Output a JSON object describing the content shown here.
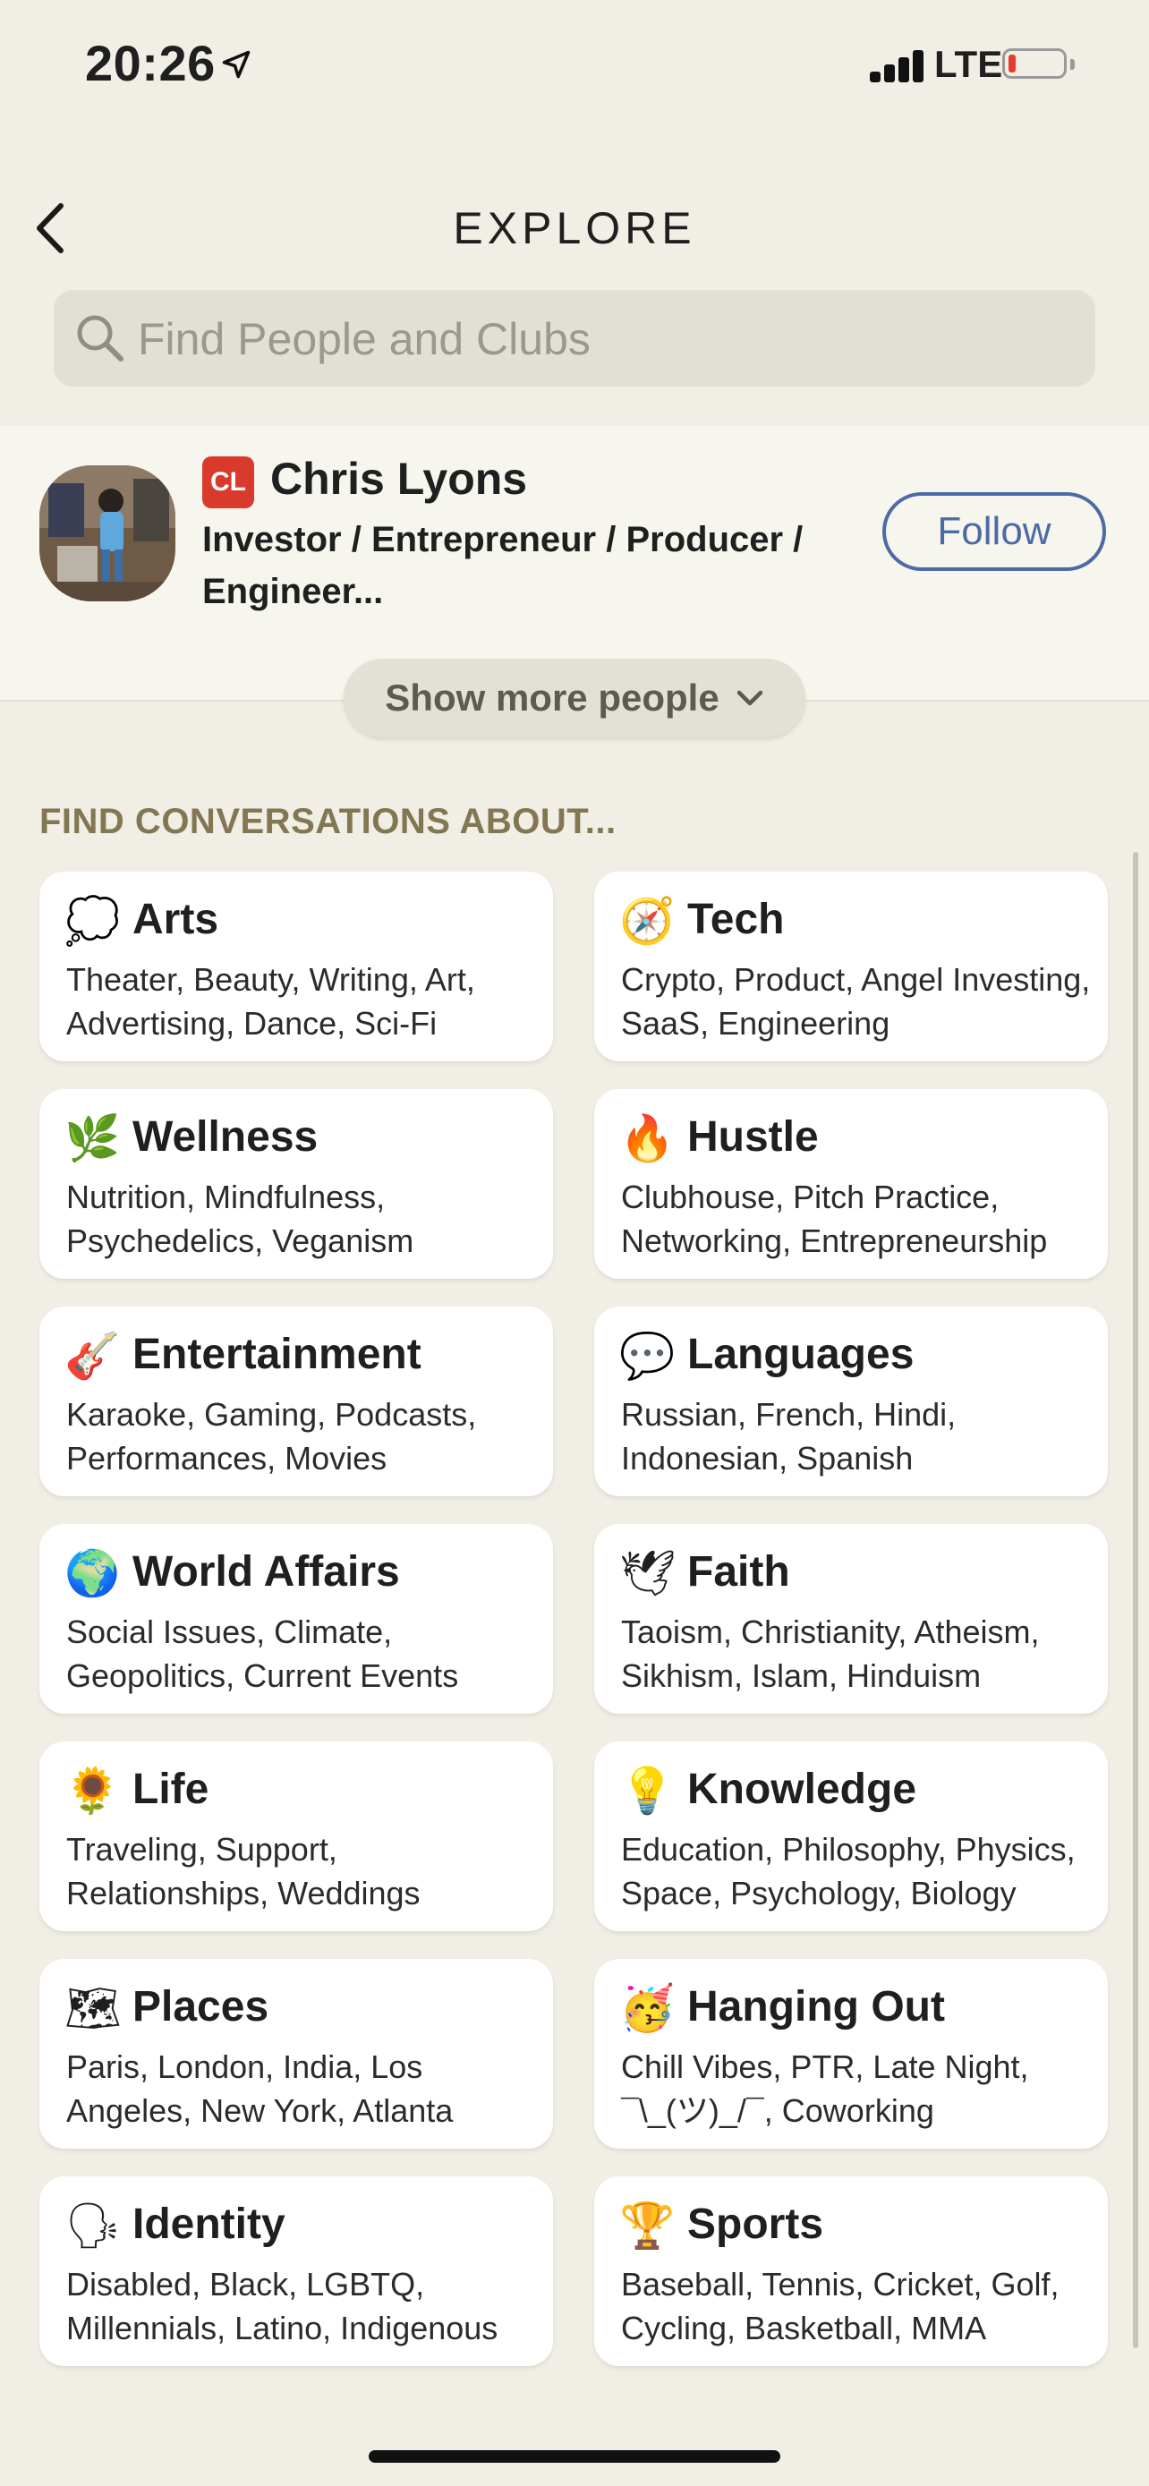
{
  "status_bar": {
    "time": "20:26",
    "network": "LTE",
    "battery_level": 0.1
  },
  "header": {
    "title": "EXPLORE"
  },
  "search": {
    "placeholder": "Find People and Clubs"
  },
  "suggested_person": {
    "badge": "CL",
    "name": "Chris Lyons",
    "description": "Investor / Entrepreneur / Producer / Engineer...",
    "follow_label": "Follow"
  },
  "show_more_label": "Show more people",
  "section_label": "FIND CONVERSATIONS ABOUT...",
  "categories": [
    {
      "emoji": "💭",
      "icon": "thought-balloon-icon",
      "title": "Arts",
      "topics": "Theater, Beauty, Writing, Art, Advertising, Dance, Sci-Fi"
    },
    {
      "emoji": "🧭",
      "icon": "compass-icon",
      "title": "Tech",
      "topics": "Crypto, Product, Angel Investing, SaaS, Engineering"
    },
    {
      "emoji": "🌿",
      "icon": "herb-icon",
      "title": "Wellness",
      "topics": "Nutrition, Mindfulness, Psychedelics, Veganism"
    },
    {
      "emoji": "🔥",
      "icon": "fire-icon",
      "title": "Hustle",
      "topics": "Clubhouse, Pitch Practice, Networking, Entrepreneurship"
    },
    {
      "emoji": "🎸",
      "icon": "guitar-icon",
      "title": "Entertainment",
      "topics": "Karaoke, Gaming, Podcasts, Performances, Movies"
    },
    {
      "emoji": "💬",
      "icon": "speech-bubble-icon",
      "title": "Languages",
      "topics": "Russian, French, Hindi, Indonesian, Spanish"
    },
    {
      "emoji": "🌍",
      "icon": "globe-icon",
      "title": "World Affairs",
      "topics": "Social Issues, Climate, Geopolitics, Current Events"
    },
    {
      "emoji": "🕊",
      "icon": "dove-icon",
      "title": "Faith",
      "topics": "Taoism, Christianity, Atheism, Sikhism, Islam, Hinduism"
    },
    {
      "emoji": "🌻",
      "icon": "sunflower-icon",
      "title": "Life",
      "topics": "Traveling, Support, Relationships, Weddings"
    },
    {
      "emoji": "💡",
      "icon": "light-bulb-icon",
      "title": "Knowledge",
      "topics": "Education, Philosophy, Physics, Space, Psychology, Biology"
    },
    {
      "emoji": "🗺",
      "icon": "world-map-icon",
      "title": "Places",
      "topics": "Paris, London, India, Los Angeles, New York, Atlanta"
    },
    {
      "emoji": "🥳",
      "icon": "party-face-icon",
      "title": "Hanging Out",
      "topics": "Chill Vibes, PTR, Late Night, ¯\\_(ツ)_/¯, Coworking"
    },
    {
      "emoji": "🗣",
      "icon": "speaking-head-icon",
      "title": "Identity",
      "topics": "Disabled, Black, LGBTQ, Millennials, Latino, Indigenous"
    },
    {
      "emoji": "🏆",
      "icon": "trophy-icon",
      "title": "Sports",
      "topics": "Baseball, Tennis, Cricket, Golf, Cycling, Basketball, MMA"
    }
  ],
  "colors": {
    "background": "#f1efe5",
    "accent_blue": "#4e6aa5",
    "section_label": "#827752",
    "badge_red": "#d93a2b"
  }
}
